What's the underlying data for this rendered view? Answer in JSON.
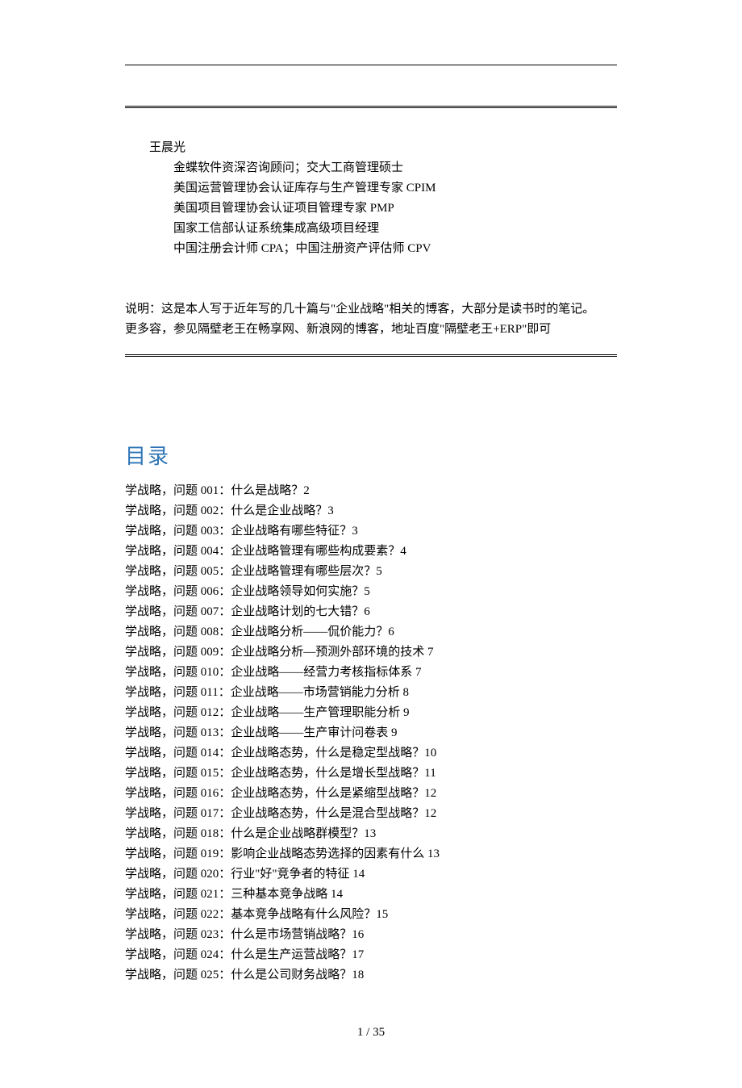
{
  "author": {
    "name": "王晨光",
    "credentials": [
      "金蝶软件资深咨询顾问；交大工商管理硕士",
      "美国运营管理协会认证库存与生产管理专家 CPIM",
      "美国项目管理协会认证项目管理专家 PMP",
      "国家工信部认证系统集成高级项目经理",
      "中国注册会计师 CPA；中国注册资产评估师 CPV"
    ]
  },
  "description": {
    "line1": "说明：这是本人写于近年写的几十篇与\"企业战略\"相关的博客，大部分是读书时的笔记。",
    "line2": "更多容，参见隔壁老王在畅享网、新浪网的博客，地址百度\"隔壁老王+ERP\"即可"
  },
  "toc_title": "目录",
  "toc": [
    "学战略，问题 001：什么是战略？2",
    "学战略，问题 002：什么是企业战略？3",
    "学战略，问题 003：企业战略有哪些特征？3",
    "学战略，问题 004：企业战略管理有哪些构成要素？4",
    "学战略，问题 005：企业战略管理有哪些层次？5",
    "学战略，问题 006：企业战略领导如何实施？5",
    "学战略，问题 007：企业战略计划的七大错？6",
    "学战略，问题 008：企业战略分析——侃价能力？6",
    "学战略，问题 009：企业战略分析—预测外部环境的技术 7",
    "学战略，问题 010：企业战略——经营力考核指标体系 7",
    "学战略，问题 011：企业战略——市场营销能力分析 8",
    "学战略，问题 012：企业战略——生产管理职能分析 9",
    "学战略，问题 013：企业战略——生产审计问卷表 9",
    "学战略，问题 014：企业战略态势，什么是稳定型战略？10",
    "学战略，问题 015：企业战略态势，什么是增长型战略？11",
    "学战略，问题 016：企业战略态势，什么是紧缩型战略？12",
    "学战略，问题 017：企业战略态势，什么是混合型战略？12",
    "学战略，问题 018：什么是企业战略群模型？13",
    "学战略，问题 019：影响企业战略态势选择的因素有什么 13",
    "学战略，问题 020：行业\"好\"竞争者的特征 14",
    "学战略，问题 021：三种基本竞争战略 14",
    "学战略，问题 022：基本竞争战略有什么风险？15",
    "学战略，问题 023：什么是市场营销战略？16",
    "学战略，问题 024：什么是生产运营战略？17",
    "学战略，问题 025：什么是公司财务战略？18"
  ],
  "footer": "1 / 35"
}
